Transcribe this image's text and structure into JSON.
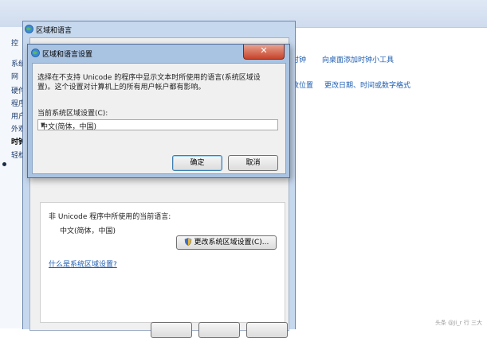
{
  "control_panel": {
    "left_items": [
      "控",
      "系统",
      "网",
      "硬件",
      "程序",
      "用户",
      "外观",
      "时钟",
      "轻松"
    ],
    "links": [
      "时钟",
      "向桌面添加时钟小工具",
      "改位置",
      "更改日期、时间或数字格式"
    ]
  },
  "outer_dialog": {
    "title": "区域和语言",
    "nonunicode_label": "非 Unicode 程序中所使用的当前语言:",
    "current_language": "中文(简体，中国)",
    "change_button": "更改系统区域设置(C)...",
    "help_link": "什么是系统区域设置?"
  },
  "dialog": {
    "title": "区域和语言设置",
    "description": "选择在不支持 Unicode 的程序中显示文本时所使用的语言(系统区域设置)。这个设置对计算机上的所有用户帐户都有影响。",
    "locale_label": "当前系统区域设置(C):",
    "locale_value": "中文(简体，中国)",
    "ok_label": "确定",
    "cancel_label": "取消"
  },
  "watermark": "头条 @Ji_r 行 三大"
}
